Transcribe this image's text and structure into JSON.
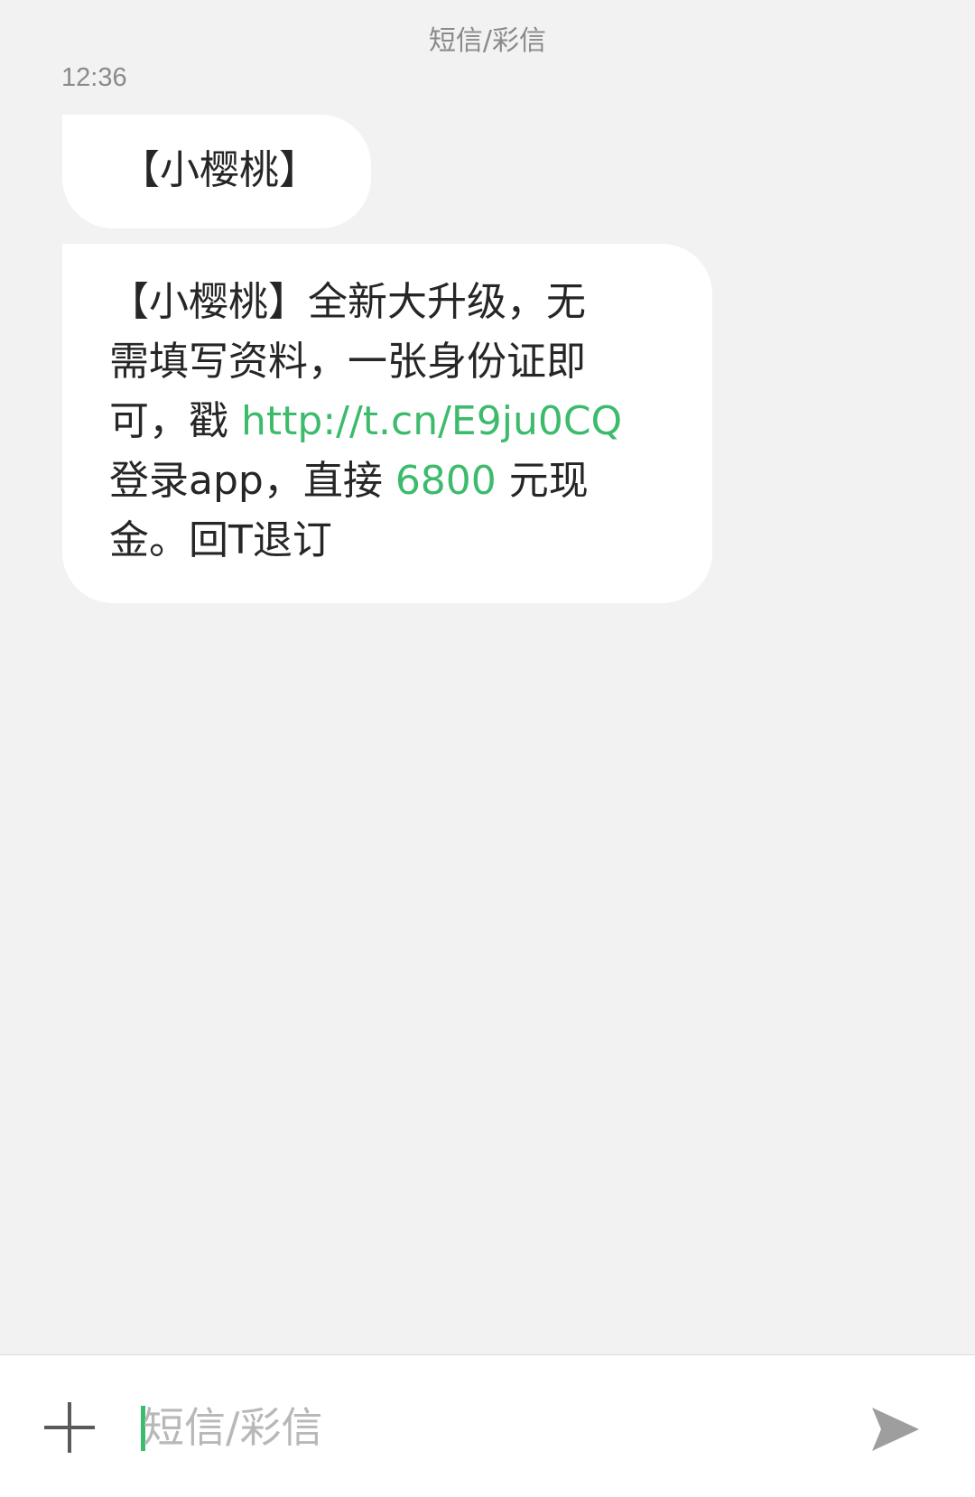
{
  "header": {
    "title": "短信/彩信"
  },
  "timestamp": "12:36",
  "messages": [
    {
      "text": "【小樱桃】"
    },
    {
      "lines": [
        {
          "text": "【小樱桃】全新大升级，无"
        },
        {
          "text": "需填写资料，一张身份证即"
        },
        {
          "prefix": "可，戳 ",
          "link": "http://t.cn/E9ju0CQ"
        },
        {
          "prefix": "登录app，直接 ",
          "amount": "6800",
          "suffix": " 元现"
        },
        {
          "text": "金。回T退订"
        }
      ]
    }
  ],
  "composer": {
    "placeholder": "短信/彩信",
    "value": "",
    "attach_icon": "plus-icon",
    "send_icon": "send-icon"
  },
  "colors": {
    "background": "#f2f2f2",
    "bubble": "#ffffff",
    "accent": "#3dbb6c",
    "text": "#262626",
    "muted": "#8a8a8a"
  }
}
